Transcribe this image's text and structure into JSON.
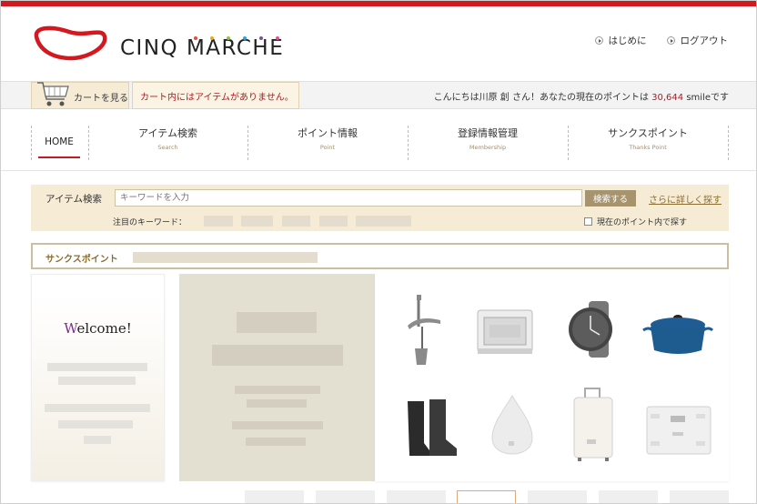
{
  "header": {
    "logo_text": "CINQ MARCHE",
    "links": [
      {
        "label": "はじめに"
      },
      {
        "label": "ログアウト"
      }
    ]
  },
  "cartbar": {
    "view_cart": "カートを見る",
    "cart_message": "カート内にはアイテムがありません。",
    "greeting_prefix": "こんにちは川原 創 さん！あなたの現在のポイントは",
    "points": "30,644",
    "greeting_suffix": "smileです"
  },
  "nav": {
    "home": "HOME",
    "items": [
      {
        "jp": "アイテム検索",
        "en": "Search"
      },
      {
        "jp": "ポイント情報",
        "en": "Point"
      },
      {
        "jp": "登録情報管理",
        "en": "Membership"
      },
      {
        "jp": "サンクスポイント",
        "en": "Thanks Point"
      }
    ]
  },
  "search": {
    "label": "アイテム検索",
    "placeholder": "キーワードを入力",
    "button": "検索する",
    "advanced": "さらに詳しく探す",
    "keywords_label": "注目のキーワード：",
    "checkbox_label": "現在のポイント内で探す"
  },
  "thanks": {
    "label": "サンクスポイント"
  },
  "welcome": {
    "title_first": "W",
    "title_rest": "elcome!"
  },
  "colors": {
    "brand_red": "#d4181f",
    "gold": "#a7946c",
    "cream": "#f6ecd6"
  },
  "products": [
    {
      "icon": "desk-lamp-icon"
    },
    {
      "icon": "microwave-oven-icon"
    },
    {
      "icon": "wrist-watch-icon"
    },
    {
      "icon": "dutch-oven-pot-icon"
    },
    {
      "icon": "rain-boots-icon"
    },
    {
      "icon": "humidifier-icon"
    },
    {
      "icon": "suitcase-icon"
    },
    {
      "icon": "bathroom-scale-icon"
    }
  ]
}
